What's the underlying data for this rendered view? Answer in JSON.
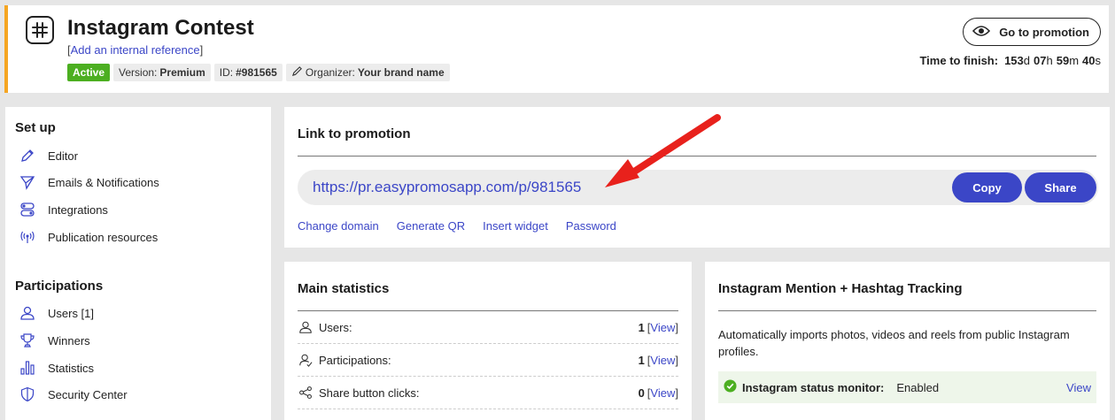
{
  "header": {
    "title": "Instagram Contest",
    "ref_open": "[",
    "ref_link": "Add an internal reference",
    "ref_close": "]",
    "badges": {
      "status": "Active",
      "version_label": "Version:",
      "version_value": "Premium",
      "id_label": "ID:",
      "id_value": "#981565",
      "organizer_label": "Organizer:",
      "organizer_value": "Your brand name"
    },
    "goto_label": "Go to promotion",
    "timer": {
      "label": "Time to finish:",
      "days": "153",
      "days_unit": "d",
      "hours": "07",
      "hours_unit": "h",
      "minutes": "59",
      "minutes_unit": "m",
      "seconds": "40",
      "seconds_unit": "s"
    }
  },
  "sidebar": {
    "setup_title": "Set up",
    "setup_items": [
      {
        "label": "Editor",
        "icon": "pencil-icon"
      },
      {
        "label": "Emails & Notifications",
        "icon": "send-icon"
      },
      {
        "label": "Integrations",
        "icon": "toggles-icon"
      },
      {
        "label": "Publication resources",
        "icon": "broadcast-icon"
      }
    ],
    "participations_title": "Participations",
    "participation_items": [
      {
        "label": "Users [1]",
        "icon": "user-icon"
      },
      {
        "label": "Winners",
        "icon": "trophy-icon"
      },
      {
        "label": "Statistics",
        "icon": "bar-chart-icon"
      },
      {
        "label": "Security Center",
        "icon": "shield-icon"
      }
    ]
  },
  "link_card": {
    "title": "Link to promotion",
    "url": "https://pr.easypromosapp.com/p/981565",
    "copy_label": "Copy",
    "share_label": "Share",
    "links": [
      "Change domain",
      "Generate QR",
      "Insert widget",
      "Password"
    ]
  },
  "stats_card": {
    "title": "Main statistics",
    "rows": [
      {
        "label": "Users:",
        "value": "1",
        "view": "View",
        "icon": "user-icon"
      },
      {
        "label": "Participations:",
        "value": "1",
        "view": "View",
        "icon": "participations-icon"
      },
      {
        "label": "Share button clicks:",
        "value": "0",
        "view": "View",
        "icon": "share-icon"
      }
    ]
  },
  "insta_card": {
    "title": "Instagram Mention + Hashtag Tracking",
    "description": "Automatically imports photos, videos and reels from public Instagram profiles.",
    "status_label": "Instagram status monitor:",
    "status_value": "Enabled",
    "view": "View"
  },
  "colors": {
    "accent": "#3b46c7",
    "active_badge": "#4caf21",
    "header_border": "#f5a623",
    "annotation_arrow": "#e8211c"
  }
}
